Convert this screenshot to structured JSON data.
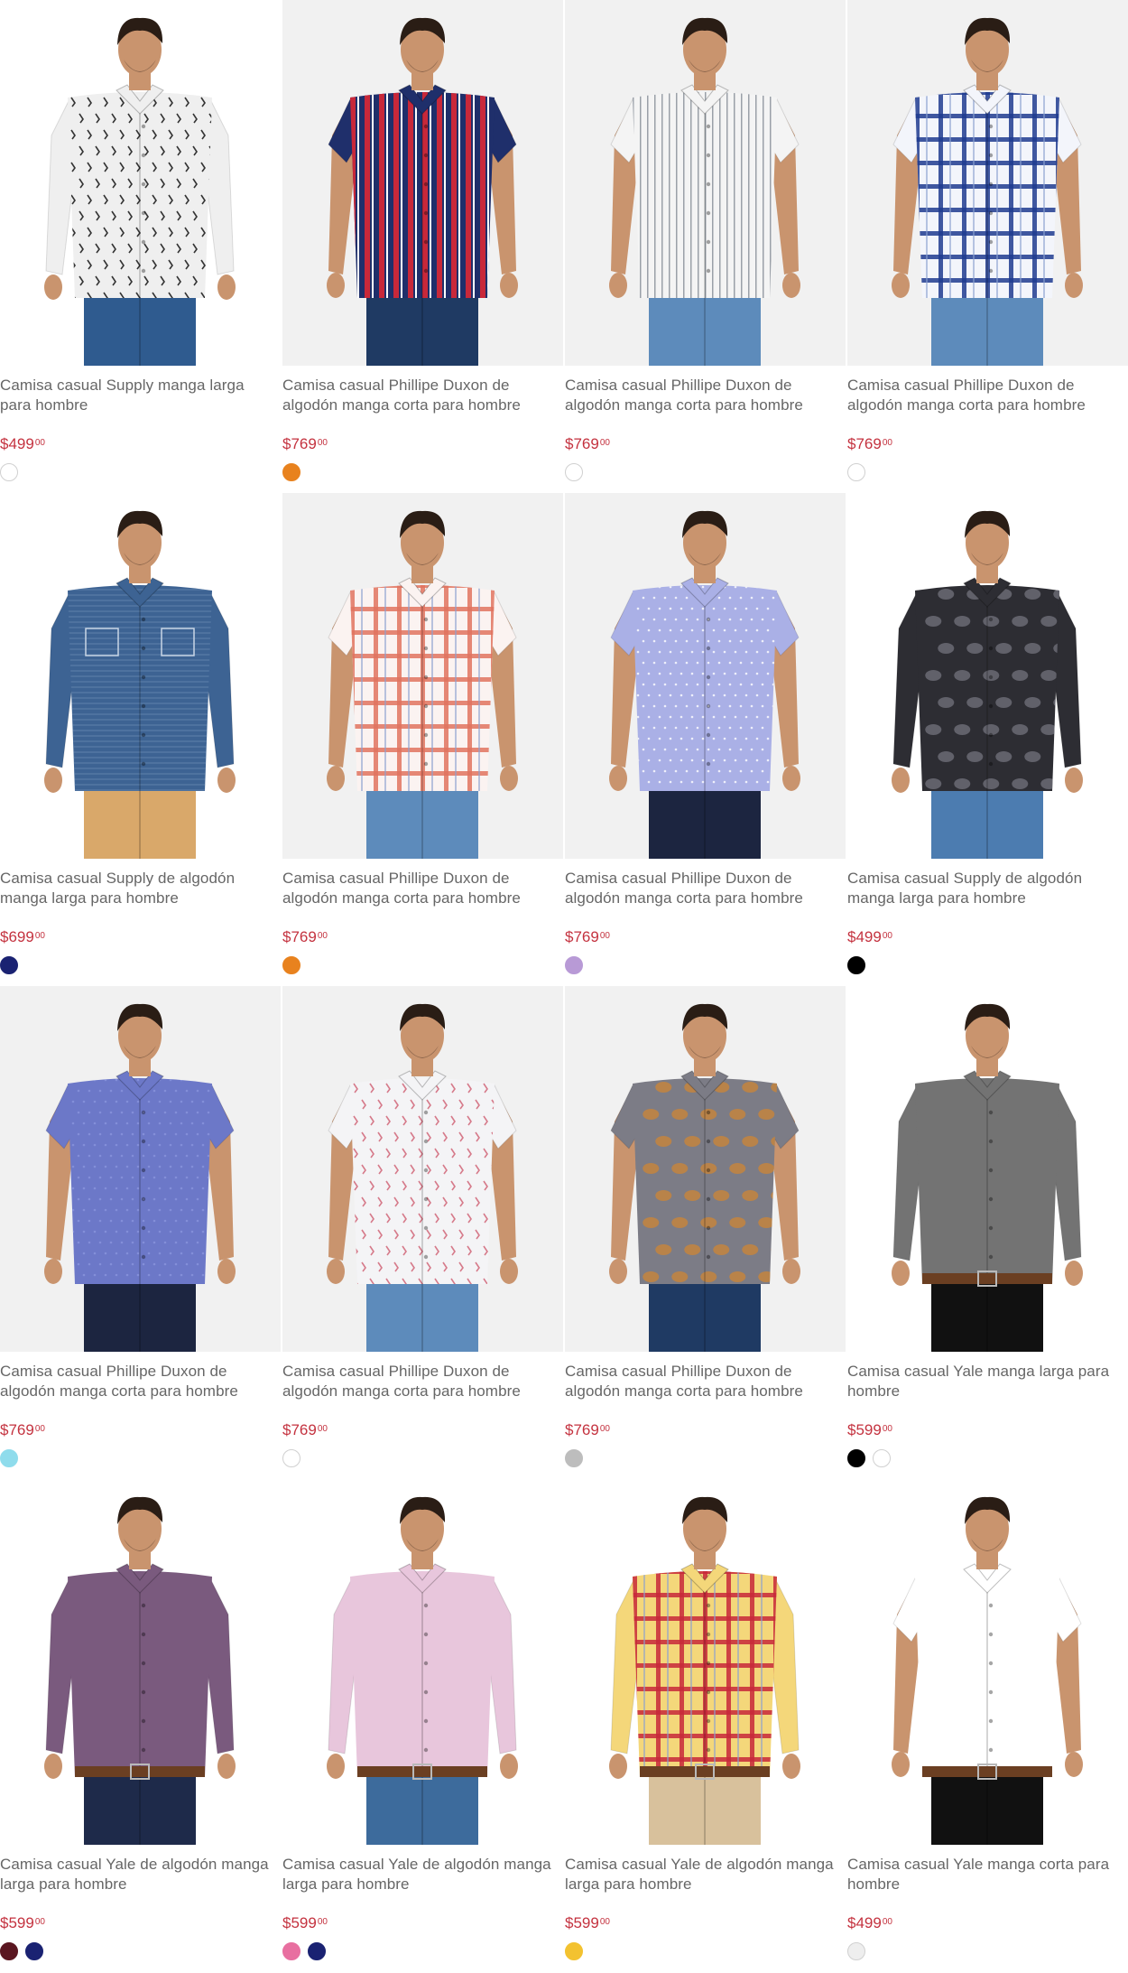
{
  "products": [
    {
      "title": "Camisa casual Supply manga larga para hombre",
      "price": "$499",
      "cents": "00",
      "bg": "#ffffff",
      "shirt": "#efefef",
      "pattern": "print-dark",
      "pcolor": "#333333",
      "sleeve": "long",
      "pants": "#2f5b8f",
      "swatches": [
        "#ffffff"
      ]
    },
    {
      "title": "Camisa casual Phillipe Duxon de algodón manga corta para hombre",
      "price": "$769",
      "cents": "00",
      "bg": "#f1f1f1",
      "shirt": "#1f2f6b",
      "pattern": "stripes",
      "pcolor": "#c8283a",
      "sleeve": "short",
      "pants": "#1f3a63",
      "swatches": [
        "#e8821e"
      ]
    },
    {
      "title": "Camisa casual Phillipe Duxon de algodón manga corta para hombre",
      "price": "$769",
      "cents": "00",
      "bg": "#f1f1f1",
      "shirt": "#f4f4f4",
      "pattern": "stripes-thin",
      "pcolor": "#9aa0a8",
      "sleeve": "short",
      "pants": "#5d8bbb",
      "swatches": [
        "#ffffff"
      ]
    },
    {
      "title": "Camisa casual Phillipe Duxon de algodón manga corta para hombre",
      "price": "$769",
      "cents": "00",
      "bg": "#f1f1f1",
      "shirt": "#f3f5fb",
      "pattern": "plaid",
      "pcolor": "#1f3b8f",
      "sleeve": "short",
      "pants": "#5d8bbb",
      "swatches": [
        "#ffffff"
      ]
    },
    {
      "title": "Camisa casual Supply de algodón manga larga para hombre",
      "price": "$699",
      "cents": "00",
      "bg": "#ffffff",
      "shirt": "#3d6393",
      "pattern": "denim",
      "pcolor": "#6f8fb8",
      "sleeve": "long",
      "pants": "#d9a86a",
      "swatches": [
        "#1a2272"
      ]
    },
    {
      "title": "Camisa casual Phillipe Duxon de algodón manga corta para hombre",
      "price": "$769",
      "cents": "00",
      "bg": "#f1f1f1",
      "shirt": "#fbf3f1",
      "pattern": "plaid",
      "pcolor": "#e0735f",
      "sleeve": "short",
      "pants": "#5d8bbb",
      "swatches": [
        "#e8821e"
      ]
    },
    {
      "title": "Camisa casual Phillipe Duxon de algodón manga corta para hombre",
      "price": "$769",
      "cents": "00",
      "bg": "#f1f1f1",
      "shirt": "#aab0e6",
      "pattern": "dots",
      "pcolor": "#ffffff",
      "sleeve": "short",
      "pants": "#1c2540",
      "swatches": [
        "#b89ad6"
      ]
    },
    {
      "title": "Camisa casual Supply de algodón manga larga para hombre",
      "price": "$499",
      "cents": "00",
      "bg": "#ffffff",
      "shirt": "#2d2d33",
      "pattern": "floral",
      "pcolor": "#6e6e78",
      "sleeve": "long",
      "pants": "#4c7cb0",
      "swatches": [
        "#000000"
      ]
    },
    {
      "title": "Camisa casual Phillipe Duxon de algodón manga corta para hombre",
      "price": "$769",
      "cents": "00",
      "bg": "#f1f1f1",
      "shirt": "#6c78c8",
      "pattern": "dots",
      "pcolor": "#8a95dd",
      "sleeve": "short",
      "pants": "#1c2540",
      "swatches": [
        "#8fdcec"
      ]
    },
    {
      "title": "Camisa casual Phillipe Duxon de algodón manga corta para hombre",
      "price": "$769",
      "cents": "00",
      "bg": "#f1f1f1",
      "shirt": "#f4f4f6",
      "pattern": "print-color",
      "pcolor": "#d67a8a",
      "sleeve": "short",
      "pants": "#5d8bbb",
      "swatches": [
        "#ffffff"
      ]
    },
    {
      "title": "Camisa casual Phillipe Duxon de algodón manga corta para hombre",
      "price": "$769",
      "cents": "00",
      "bg": "#f1f1f1",
      "shirt": "#7c7c86",
      "pattern": "paisley",
      "pcolor": "#c8843a",
      "sleeve": "short",
      "pants": "#1f3a63",
      "swatches": [
        "#bdbdbd"
      ]
    },
    {
      "title": "Camisa casual Yale manga larga para hombre",
      "price": "$599",
      "cents": "00",
      "bg": "#ffffff",
      "shirt": "#737373",
      "pattern": "none",
      "pcolor": "#737373",
      "sleeve": "long",
      "pants": "#111111",
      "swatches": [
        "#000000",
        "#ffffff"
      ]
    },
    {
      "title": "Camisa casual Yale de algodón manga larga para hombre",
      "price": "$599",
      "cents": "00",
      "bg": "#ffffff",
      "shirt": "#7a5a7e",
      "pattern": "none",
      "pcolor": "#7a5a7e",
      "sleeve": "long",
      "pants": "#1e2a4a",
      "swatches": [
        "#5a1620",
        "#1a2272"
      ]
    },
    {
      "title": "Camisa casual Yale de algodón manga larga para hombre",
      "price": "$599",
      "cents": "00",
      "bg": "#ffffff",
      "shirt": "#e8c6dc",
      "pattern": "none",
      "pcolor": "#e8c6dc",
      "sleeve": "long",
      "pants": "#3d6b9c",
      "swatches": [
        "#e86fa0",
        "#1a2272"
      ]
    },
    {
      "title": "Camisa casual Yale de algodón manga larga para hombre",
      "price": "$599",
      "cents": "00",
      "bg": "#ffffff",
      "shirt": "#f4d77a",
      "pattern": "plaid",
      "pcolor": "#c7283a",
      "sleeve": "long",
      "pants": "#d8c19c",
      "swatches": [
        "#f3c230"
      ]
    },
    {
      "title": "Camisa casual Yale manga corta para hombre",
      "price": "$499",
      "cents": "00",
      "bg": "#ffffff",
      "shirt": "#ffffff",
      "pattern": "none",
      "pcolor": "#e0e0e0",
      "sleeve": "short",
      "pants": "#111111",
      "swatches": [
        "#eeeeee"
      ]
    }
  ]
}
